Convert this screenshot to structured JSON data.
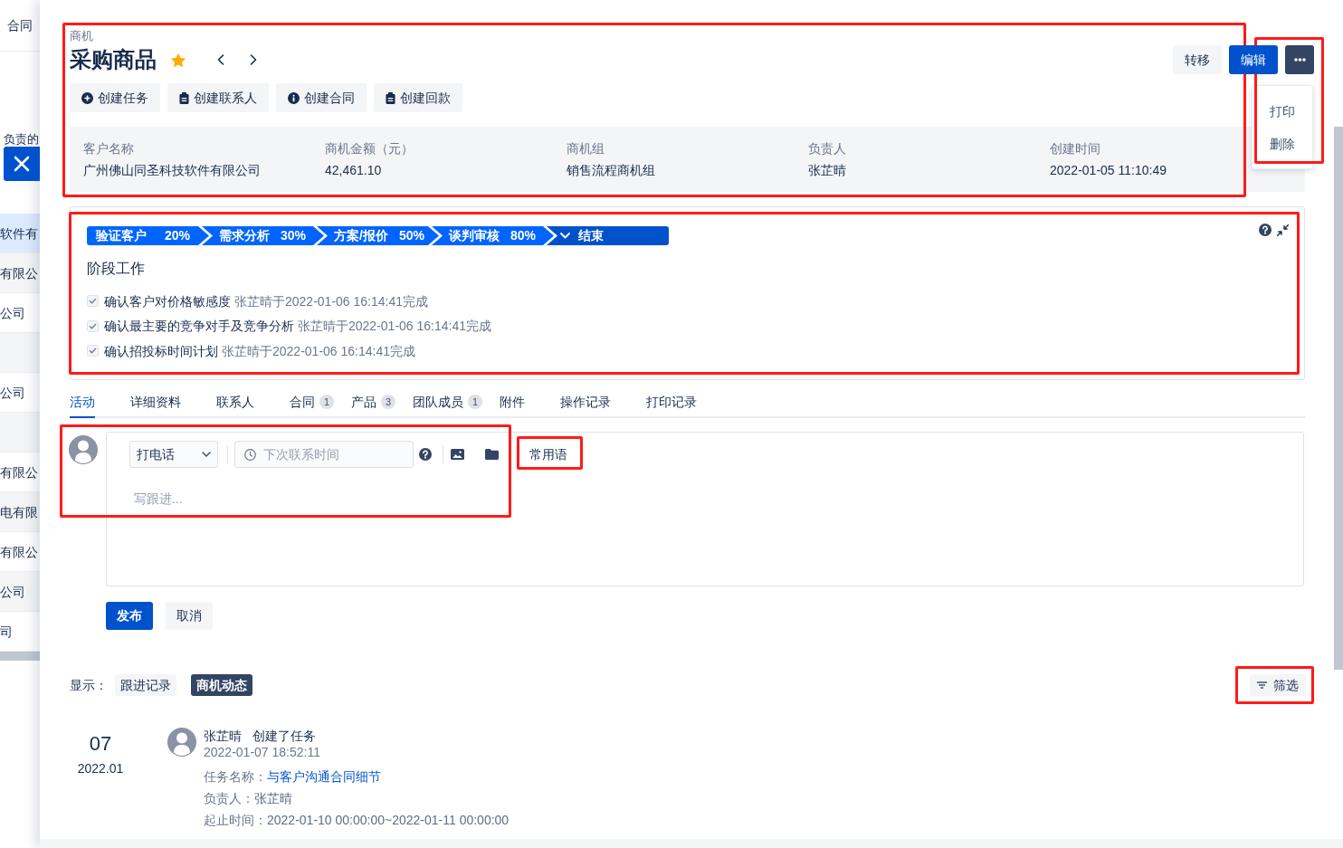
{
  "background_list": {
    "tab": "合同",
    "filter_text": "负责的",
    "rows": [
      {
        "text": "软件有",
        "selected": true
      },
      {
        "text": "有限公",
        "selected": false
      },
      {
        "text": "公司",
        "selected": false
      },
      {
        "selected": false
      },
      {
        "text": "公司",
        "selected": false
      },
      {
        "selected": false
      },
      {
        "text": "有限公",
        "selected": false
      },
      {
        "text": "电有限",
        "selected": false
      },
      {
        "text": "有限公",
        "selected": false
      },
      {
        "text": "公司",
        "selected": false
      },
      {
        "text": "司",
        "selected": false
      }
    ]
  },
  "header": {
    "type_label": "商机",
    "title": "采购商品",
    "starred": true,
    "highlighted": true,
    "buttons": [
      {
        "kind": "secondary",
        "label": "转移"
      },
      {
        "kind": "primary",
        "label": "编辑"
      },
      {
        "kind": "more"
      }
    ]
  },
  "more_menu": {
    "open": true,
    "highlighted": true,
    "items": [
      "打印",
      "删除"
    ]
  },
  "quick_actions": [
    {
      "kind": "task",
      "label": "创建任务"
    },
    {
      "kind": "contact",
      "label": "创建联系人"
    },
    {
      "kind": "contract",
      "label": "创建合同"
    },
    {
      "kind": "payment",
      "label": "创建回款"
    }
  ],
  "summary": [
    {
      "label": "客户名称",
      "value": "广州佛山同圣科技软件有限公司"
    },
    {
      "label": "商机金额（元）",
      "value": "42,461.10"
    },
    {
      "label": "商机组",
      "value": "销售流程商机组"
    },
    {
      "label": "负责人",
      "value": "张芷晴"
    },
    {
      "label": "创建时间",
      "value": "2022-01-05 11:10:49"
    }
  ],
  "stage_panel": {
    "highlighted": true,
    "stages": [
      {
        "name": "验证客户",
        "percent": "20%",
        "selected": false
      },
      {
        "name": "需求分析",
        "percent": "30%",
        "selected": false
      },
      {
        "name": "方案/报价",
        "percent": "50%",
        "selected": false
      },
      {
        "name": "谈判审核",
        "percent": "80%",
        "selected": false
      },
      {
        "name": "结束",
        "selected": true
      }
    ],
    "work_title": "阶段工作",
    "tasks": [
      {
        "text": "确认客户对价格敏感度",
        "note": "张芷晴于2022-01-06 16:14:41完成",
        "checked": true
      },
      {
        "text": "确认最主要的竞争对手及竞争分析",
        "note": "张芷晴于2022-01-06 16:14:41完成",
        "checked": true
      },
      {
        "text": "确认招投标时间计划",
        "note": "张芷晴于2022-01-06 16:14:41完成",
        "checked": true
      }
    ]
  },
  "tabs": [
    {
      "label": "活动",
      "selected": true
    },
    {
      "label": "详细资料",
      "selected": false
    },
    {
      "label": "联系人",
      "selected": false
    },
    {
      "label": "合同",
      "count": "1",
      "selected": false
    },
    {
      "label": "产品",
      "count": "3",
      "selected": false
    },
    {
      "label": "团队成员",
      "count": "1",
      "selected": false
    },
    {
      "label": "附件",
      "selected": false
    },
    {
      "label": "操作记录",
      "selected": false
    },
    {
      "label": "打印记录",
      "selected": false
    }
  ],
  "composer": {
    "highlighted": true,
    "activity_type": "打电话",
    "next_contact": {
      "placeholder": "下次联系时间"
    },
    "phrases_button": {
      "label": "常用语",
      "highlighted": true
    },
    "note": {
      "placeholder": "写跟进..."
    },
    "buttons": [
      {
        "kind": "primary",
        "label": "发布"
      },
      {
        "kind": "secondary",
        "label": "取消"
      }
    ]
  },
  "feed_filter": {
    "label": "显示：",
    "options": [
      {
        "label": "跟进记录",
        "selected": false
      },
      {
        "label": "商机动态",
        "selected": true
      }
    ],
    "filter_button": {
      "label": "筛选",
      "highlighted": true
    }
  },
  "timeline": [
    {
      "day": "07",
      "month": "2022.01",
      "author": "张芷晴",
      "action": "创建了任务",
      "time": "2022-01-07 18:52:11",
      "fields": [
        {
          "label": "任务名称：",
          "value": "与客户沟通合同细节",
          "kind": "link"
        },
        {
          "label": "负责人：",
          "value": "张芷晴",
          "kind": "text"
        },
        {
          "label": "起止时间：",
          "value": "2022-01-10 00:00:00~2022-01-11 00:00:00",
          "kind": "text"
        }
      ]
    }
  ]
}
